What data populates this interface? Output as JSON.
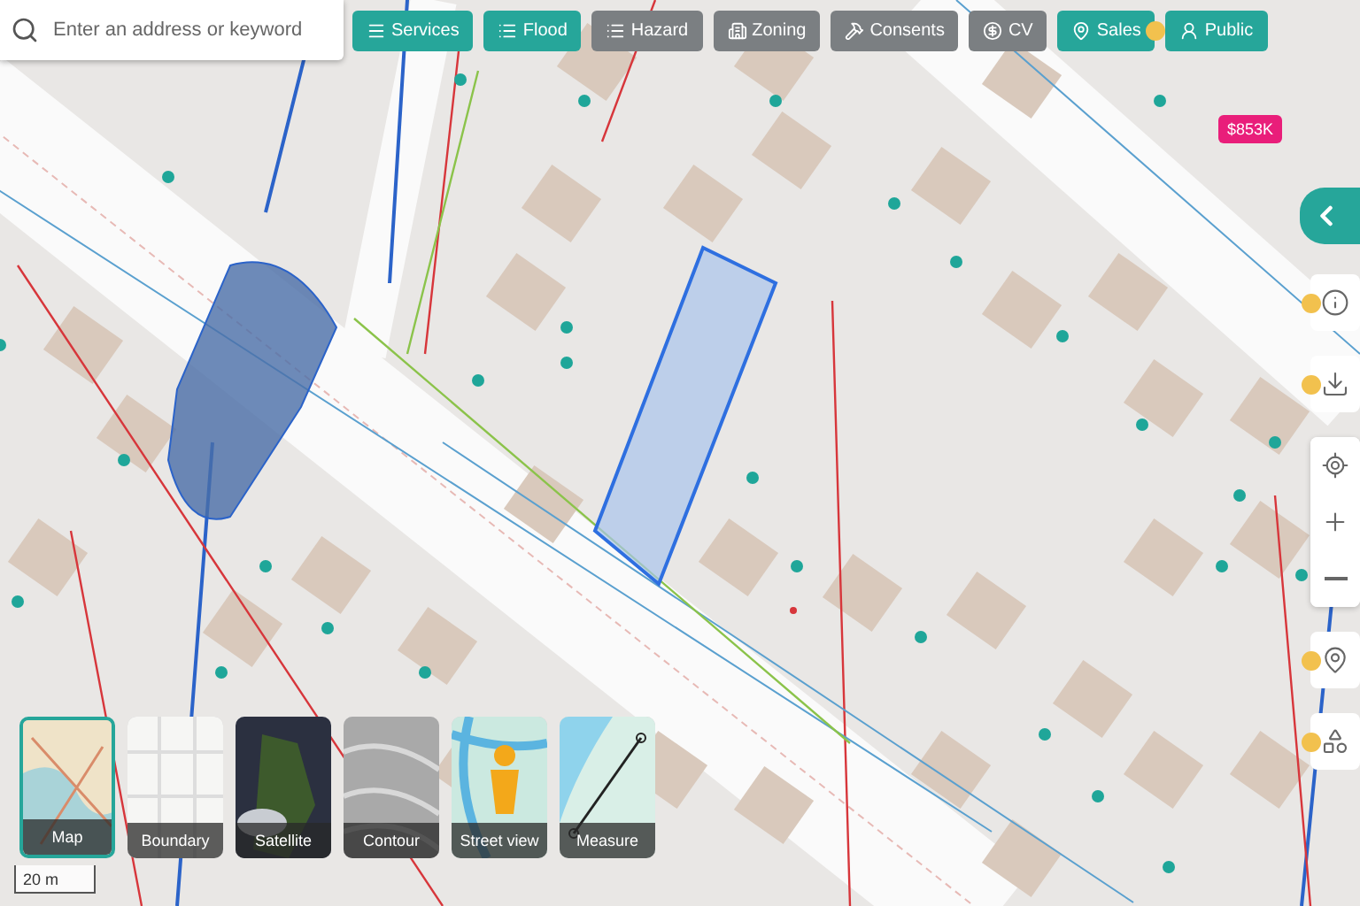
{
  "search": {
    "placeholder": "Enter an address or keyword"
  },
  "layers": [
    {
      "label": "Services",
      "kind": "services",
      "selected": true,
      "badge": false
    },
    {
      "label": "Flood",
      "kind": "flood",
      "selected": true,
      "badge": false
    },
    {
      "label": "Hazard",
      "kind": "hazard",
      "selected": false,
      "badge": false
    },
    {
      "label": "Zoning",
      "kind": "zoning",
      "selected": false,
      "badge": false
    },
    {
      "label": "Consents",
      "kind": "consents",
      "selected": false,
      "badge": false
    },
    {
      "label": "CV",
      "kind": "cv",
      "selected": false,
      "badge": false
    },
    {
      "label": "Sales",
      "kind": "sales",
      "selected": true,
      "badge": true
    },
    {
      "label": "Public",
      "kind": "public",
      "selected": true,
      "badge": false
    }
  ],
  "price_marker": {
    "label": "$853K"
  },
  "side_tools": [
    {
      "kind": "info",
      "badge": true
    },
    {
      "kind": "download",
      "badge": true
    },
    {
      "kind": "locate",
      "badge": false
    },
    {
      "kind": "zoom_in",
      "badge": false
    },
    {
      "kind": "zoom_out",
      "badge": false
    },
    {
      "kind": "pin",
      "badge": true
    },
    {
      "kind": "shape",
      "badge": true
    }
  ],
  "basemaps": [
    {
      "label": "Map",
      "kind": "map",
      "selected": true
    },
    {
      "label": "Boundary",
      "kind": "boundary",
      "selected": false
    },
    {
      "label": "Satellite",
      "kind": "satellite",
      "selected": false
    },
    {
      "label": "Contour",
      "kind": "contour",
      "selected": false
    },
    {
      "label": "Street view",
      "kind": "streetview",
      "selected": false
    },
    {
      "label": "Measure",
      "kind": "measure",
      "selected": false
    }
  ],
  "scale": {
    "label": "20 m"
  }
}
